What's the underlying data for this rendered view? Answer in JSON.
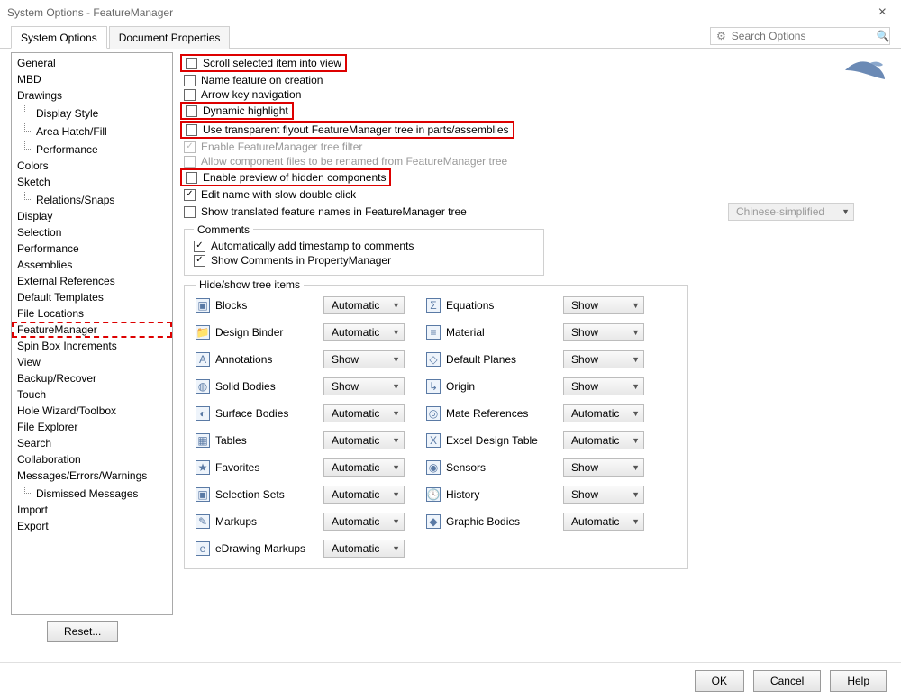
{
  "window": {
    "title": "System Options - FeatureManager"
  },
  "tabs": {
    "t0": "System Options",
    "t1": "Document Properties"
  },
  "search": {
    "placeholder": "Search Options"
  },
  "sidebar": {
    "items": [
      {
        "label": "General"
      },
      {
        "label": "MBD"
      },
      {
        "label": "Drawings"
      },
      {
        "label": "Display Style",
        "sub": true
      },
      {
        "label": "Area Hatch/Fill",
        "sub": true
      },
      {
        "label": "Performance",
        "sub": true
      },
      {
        "label": "Colors"
      },
      {
        "label": "Sketch"
      },
      {
        "label": "Relations/Snaps",
        "sub": true
      },
      {
        "label": "Display"
      },
      {
        "label": "Selection"
      },
      {
        "label": "Performance"
      },
      {
        "label": "Assemblies"
      },
      {
        "label": "External References"
      },
      {
        "label": "Default Templates"
      },
      {
        "label": "File Locations"
      },
      {
        "label": "FeatureManager",
        "selected": true
      },
      {
        "label": "Spin Box Increments"
      },
      {
        "label": "View"
      },
      {
        "label": "Backup/Recover"
      },
      {
        "label": "Touch"
      },
      {
        "label": "Hole Wizard/Toolbox"
      },
      {
        "label": "File Explorer"
      },
      {
        "label": "Search"
      },
      {
        "label": "Collaboration"
      },
      {
        "label": "Messages/Errors/Warnings"
      },
      {
        "label": "Dismissed Messages",
        "sub": true
      },
      {
        "label": "Import"
      },
      {
        "label": "Export"
      }
    ]
  },
  "checks": {
    "c0": "Scroll selected item into view",
    "c1": "Name feature on creation",
    "c2": "Arrow key navigation",
    "c3": "Dynamic highlight",
    "c4": "Use transparent flyout FeatureManager tree in parts/assemblies",
    "c5": "Enable FeatureManager tree filter",
    "c6": "Allow component files to be renamed from FeatureManager tree",
    "c7": "Enable preview of hidden components",
    "c8": "Edit name with slow double click",
    "c9": "Show translated feature names in FeatureManager tree"
  },
  "lang": {
    "value": "Chinese-simplified"
  },
  "comments": {
    "title": "Comments",
    "c0": "Automatically add timestamp to comments",
    "c1": "Show Comments in PropertyManager"
  },
  "tree": {
    "title": "Hide/show tree items",
    "left": [
      {
        "label": "Blocks",
        "val": "Automatic"
      },
      {
        "label": "Design Binder",
        "val": "Automatic"
      },
      {
        "label": "Annotations",
        "val": "Show"
      },
      {
        "label": "Solid Bodies",
        "val": "Show"
      },
      {
        "label": "Surface Bodies",
        "val": "Automatic"
      },
      {
        "label": "Tables",
        "val": "Automatic"
      },
      {
        "label": "Favorites",
        "val": "Automatic"
      },
      {
        "label": "Selection Sets",
        "val": "Automatic"
      },
      {
        "label": "Markups",
        "val": "Automatic"
      },
      {
        "label": "eDrawing Markups",
        "val": "Automatic"
      }
    ],
    "right": [
      {
        "label": "Equations",
        "val": "Show"
      },
      {
        "label": "Material",
        "val": "Show"
      },
      {
        "label": "Default Planes",
        "val": "Show"
      },
      {
        "label": "Origin",
        "val": "Show"
      },
      {
        "label": "Mate References",
        "val": "Automatic"
      },
      {
        "label": "Excel Design Table",
        "val": "Automatic"
      },
      {
        "label": "Sensors",
        "val": "Show"
      },
      {
        "label": "History",
        "val": "Show"
      },
      {
        "label": "Graphic Bodies",
        "val": "Automatic"
      }
    ]
  },
  "buttons": {
    "reset": "Reset...",
    "ok": "OK",
    "cancel": "Cancel",
    "help": "Help"
  }
}
